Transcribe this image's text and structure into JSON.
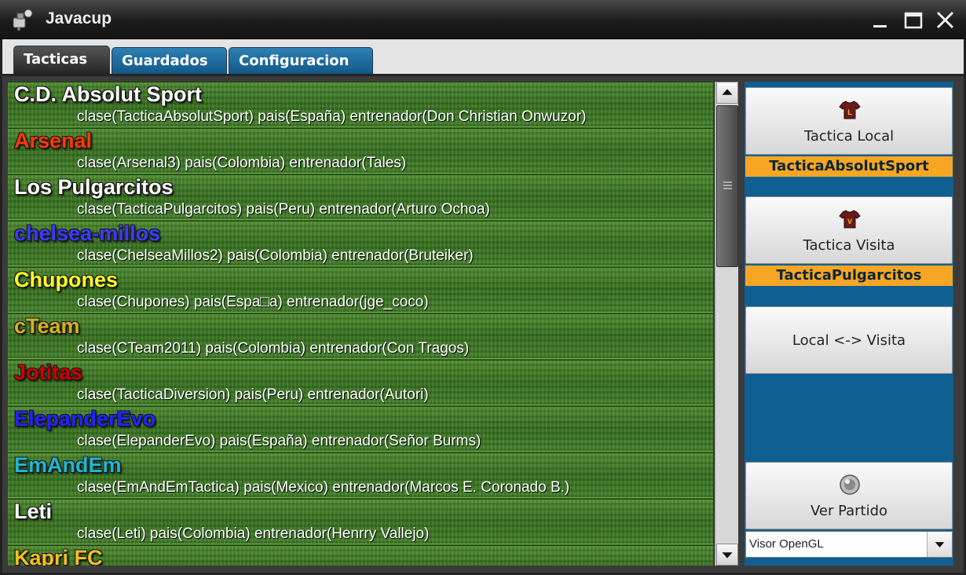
{
  "window": {
    "title": "Javacup"
  },
  "tabs": [
    {
      "label": "Tacticas",
      "active": true
    },
    {
      "label": "Guardados",
      "active": false
    },
    {
      "label": "Configuracion",
      "active": false
    }
  ],
  "teams": [
    {
      "name": "C.D. Absolut Sport",
      "info": "clase(TacticaAbsolutSport) pais(España) entrenador(Don Christian Onwuzor)",
      "color": "#ffffff"
    },
    {
      "name": "Arsenal",
      "info": "clase(Arsenal3) pais(Colombia) entrenador(Tales)",
      "color": "#ff3a00"
    },
    {
      "name": "Los Pulgarcitos",
      "info": "clase(TacticaPulgarcitos) pais(Peru) entrenador(Arturo Ochoa)",
      "color": "#ffffff"
    },
    {
      "name": "chelsea-millos",
      "info": "clase(ChelseaMillos2) pais(Colombia) entrenador(Bruteiker)",
      "color": "#3b3bff"
    },
    {
      "name": "Chupones",
      "info": "clase(Chupones) pais(Espa□a) entrenador(jge_coco)",
      "color": "#ffff22"
    },
    {
      "name": "cTeam",
      "info": "clase(CTeam2011) pais(Colombia) entrenador(Con Tragos)",
      "color": "#d4b020"
    },
    {
      "name": "Jotitas",
      "info": "clase(TacticaDiversion) pais(Peru) entrenador(Autori)",
      "color": "#cc0000"
    },
    {
      "name": "ElepanderEvo",
      "info": "clase(ElepanderEvo) pais(España) entrenador(Señor Burms)",
      "color": "#2222ff"
    },
    {
      "name": "EmAndEm",
      "info": "clase(EmAndEmTactica) pais(Mexico) entrenador(Marcos E. Coronado B.)",
      "color": "#22b5d0"
    },
    {
      "name": "Leti",
      "info": "clase(Leti) pais(Colombia) entrenador(Henrry Vallejo)",
      "color": "#ffffff"
    },
    {
      "name": "Kapri FC",
      "info": "",
      "color": "#f0c020"
    }
  ],
  "side": {
    "local_label": "Tactica Local",
    "local_value": "TacticaAbsolutSport",
    "visita_label": "Tactica Visita",
    "visita_value": "TacticaPulgarcitos",
    "swap_label": "Local <-> Visita",
    "ver_label": "Ver Partido",
    "visor_selected": "Visor OpenGL"
  },
  "colors": {
    "accent_blue": "#105f93",
    "orange": "#f7a623",
    "shirt": "#6b1a1a"
  },
  "icons": [
    "app-icon",
    "minimize-icon",
    "maximize-icon",
    "close-icon",
    "shirt-icon",
    "ball-icon",
    "chevron-down-icon",
    "scroll-up-icon",
    "scroll-down-icon"
  ]
}
